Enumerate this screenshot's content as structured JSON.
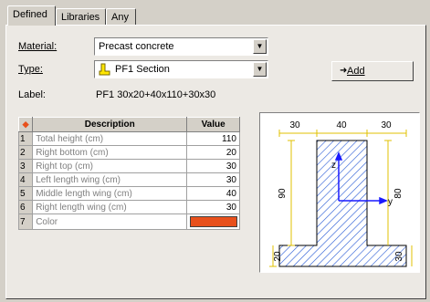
{
  "tabs": [
    {
      "label": "Defined",
      "active": true
    },
    {
      "label": "Libraries",
      "active": false
    },
    {
      "label": "Any",
      "active": false
    }
  ],
  "form": {
    "material_label": "Material:",
    "material_value": "Precast concrete",
    "type_label": "Type:",
    "type_value": "PF1 Section",
    "label_label": "Label:",
    "label_value": "PF1 30x20+40x110+30x30",
    "add_button": "Add"
  },
  "table": {
    "header_marker": "◆",
    "headers": [
      "Description",
      "Value"
    ],
    "rows": [
      {
        "index": "1",
        "description": "Total height (cm)",
        "value": "110"
      },
      {
        "index": "2",
        "description": "Right bottom (cm)",
        "value": "20"
      },
      {
        "index": "3",
        "description": "Right top (cm)",
        "value": "30"
      },
      {
        "index": "4",
        "description": "Left length wing (cm)",
        "value": "30"
      },
      {
        "index": "5",
        "description": "Middle length wing (cm)",
        "value": "40"
      },
      {
        "index": "6",
        "description": "Right length wing (cm)",
        "value": "30"
      },
      {
        "index": "7",
        "description": "Color",
        "value": ""
      }
    ],
    "color_swatch": "#e8501c"
  },
  "diagram": {
    "dim_top_left": "30",
    "dim_top_mid": "40",
    "dim_top_right": "30",
    "dim_left_height": "90",
    "dim_left_bottom": "20",
    "dim_right_height": "80",
    "dim_right_bottom": "30",
    "axis_z": "z",
    "axis_y": "y",
    "dim_color": "#e0c000",
    "axis_color": "#1a1aff",
    "hatch_color": "#2a5cd6"
  },
  "icons": {
    "add": "arrow-add-icon",
    "section": "pf1-section-icon"
  }
}
